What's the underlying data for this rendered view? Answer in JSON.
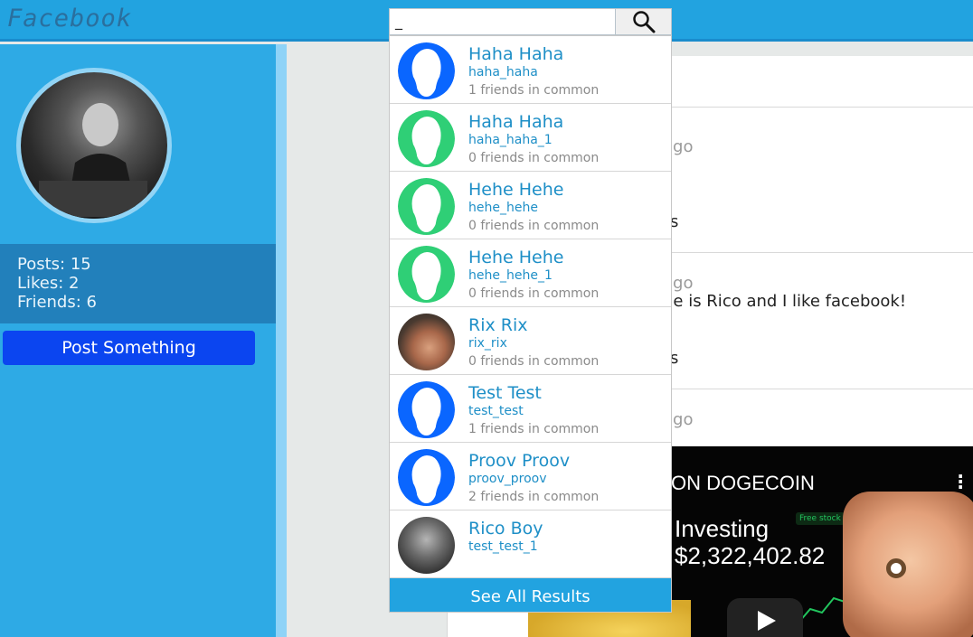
{
  "app": {
    "title": "Facebook"
  },
  "search": {
    "value": "_",
    "button_icon": "search-icon"
  },
  "profile": {
    "stats": {
      "posts": "Posts: 15",
      "likes": "Likes: 2",
      "friends": "Friends: 6"
    },
    "post_button": "Post Something"
  },
  "results": [
    {
      "name": "Haha Haha",
      "username": "haha_haha",
      "common": "1 friends in common",
      "avatar": "default-blue"
    },
    {
      "name": "Haha Haha",
      "username": "haha_haha_1",
      "common": "0 friends in common",
      "avatar": "default-green"
    },
    {
      "name": "Hehe Hehe",
      "username": "hehe_hehe",
      "common": "0 friends in common",
      "avatar": "default-green"
    },
    {
      "name": "Hehe Hehe",
      "username": "hehe_hehe_1",
      "common": "0 friends in common",
      "avatar": "default-green"
    },
    {
      "name": "Rix Rix",
      "username": "rix_rix",
      "common": "0 friends in common",
      "avatar": "photo"
    },
    {
      "name": "Test Test",
      "username": "test_test",
      "common": "1 friends in common",
      "avatar": "default-blue"
    },
    {
      "name": "Proov Proov",
      "username": "proov_proov",
      "common": "2 friends in common",
      "avatar": "default-blue"
    },
    {
      "name": "Rico Boy",
      "username": "test_test_1",
      "common": "",
      "avatar": "photo"
    }
  ],
  "see_all": "See All Results",
  "feed": {
    "link_fragment": "s",
    "post1_time": "ago",
    "post1_frag": "s",
    "post2_time": "ago",
    "post2_text": "ne is Rico and I like facebook!",
    "post2_frag": "s",
    "post3_time": "ago",
    "video_title": "ON DOGECOIN",
    "video_investing": "Investing",
    "video_amount": "$2,322,402.82",
    "video_badge": "Free stock"
  },
  "colors": {
    "topbar": "#22a3e0",
    "sidebar": "#2eaae5",
    "accent_blue": "#0b45f0",
    "avatar_blue": "#0a66ff",
    "avatar_green": "#2fcf76",
    "link": "#1e8fc7"
  }
}
